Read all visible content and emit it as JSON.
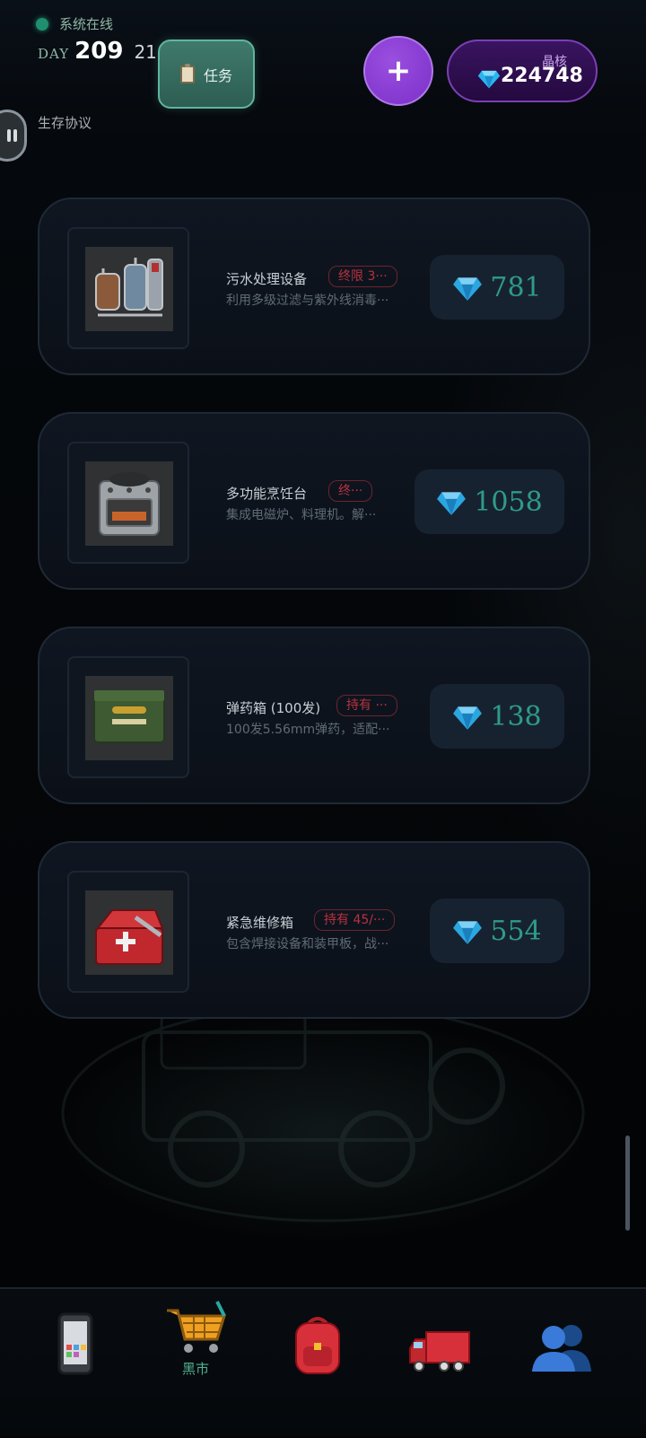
{
  "header": {
    "status_text": "系统在线",
    "day_label": "DAY",
    "day_number": "209",
    "day_sub": "21",
    "protocol_label": "生存协议",
    "task_button_label": "任务",
    "plus_button_label": "+",
    "crystal_label": "晶核",
    "crystal_value": "224748"
  },
  "items": [
    {
      "name": "污水处理设备",
      "tag": "终限 3···",
      "desc": "利用多级过滤与紫外线消毒···",
      "price": "781"
    },
    {
      "name": "多功能烹饪台",
      "tag": "终···",
      "desc": "集成电磁炉、料理机。解···",
      "price": "1058"
    },
    {
      "name": "弹药箱 (100发)",
      "tag": "持有 ···",
      "desc": "100发5.56mm弹药，适配···",
      "price": "138"
    },
    {
      "name": "紧急维修箱",
      "tag": "持有 45/···",
      "desc": "包含焊接设备和装甲板，战···",
      "price": "554"
    }
  ],
  "bottom_nav": {
    "items": [
      {
        "icon": "phone-icon",
        "label": ""
      },
      {
        "icon": "shopping-cart-icon",
        "label": "黑市"
      },
      {
        "icon": "backpack-icon",
        "label": ""
      },
      {
        "icon": "truck-icon",
        "label": ""
      },
      {
        "icon": "users-icon",
        "label": ""
      }
    ],
    "active_color": "#52b08f"
  }
}
